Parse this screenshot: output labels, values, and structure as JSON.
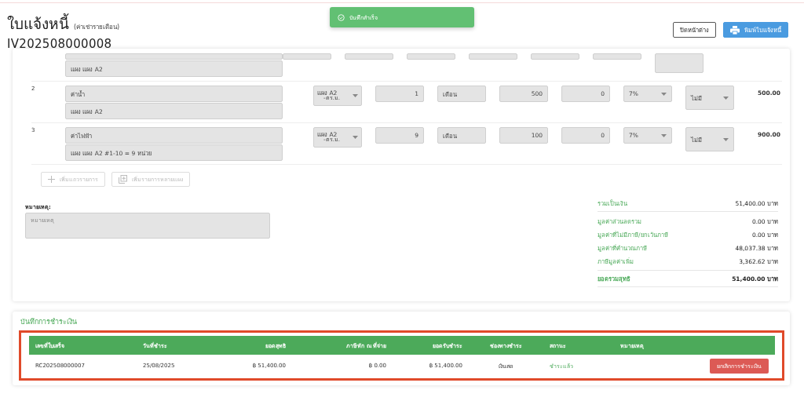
{
  "header": {
    "title": "ใบแจ้งหนี้",
    "subtitle": "(ค่าเช่ารายเดือน)",
    "number": "IV202508000008"
  },
  "toast": {
    "message": "บันทึกสำเร็จ"
  },
  "actions": [
    {
      "label": "ปิดหน้าต่าง",
      "kind": "outline"
    },
    {
      "label": "พิมพ์ใบแจ้งหนี้",
      "kind": "print"
    }
  ],
  "items": [
    {
      "kind": "partial",
      "detail": "แผง แผง A2"
    },
    {
      "kind": "full",
      "no": "2",
      "name": "ค่าน้ำ",
      "detail": "แผง แผง A2",
      "panel": "แผง A2",
      "panel_sub": "-ตร.ม.",
      "qty": "1",
      "unit": "เดือน",
      "price": "500",
      "discount": "0",
      "vat": "7%",
      "wht": "ไม่มี",
      "total": "500.00"
    },
    {
      "kind": "full",
      "no": "3",
      "name": "ค่าไฟฟ้า",
      "detail": "แผง แผง A2 #1-10 = 9 หน่วย",
      "panel": "แผง A2",
      "panel_sub": "-ตร.ม.",
      "qty": "9",
      "unit": "เดือน",
      "price": "100",
      "discount": "0",
      "vat": "7%",
      "wht": "ไม่มี",
      "total": "900.00"
    }
  ],
  "add_buttons": [
    {
      "label": "เพิ่มแถวรายการ",
      "kind": "plus",
      "disabled": true
    },
    {
      "label": "เพิ่มรายการหลายแผง",
      "kind": "multi",
      "disabled": true
    }
  ],
  "notes": {
    "label": "หมายเหตุ:",
    "placeholder": "หมายเหตุ"
  },
  "summary": [
    {
      "label": "รวมเป็นเงิน",
      "value": "51,400.00 บาท",
      "kind": "subtotal"
    },
    {
      "label": "มูลค่าส่วนลดรวม",
      "value": "0.00 บาท",
      "kind": "line"
    },
    {
      "label": "มูลค่าที่ไม่มีภาษี/ยกเว้นภาษี",
      "value": "0.00 บาท",
      "kind": "line"
    },
    {
      "label": "มูลค่าที่คำนวณภาษี",
      "value": "48,037.38 บาท",
      "kind": "line"
    },
    {
      "label": "ภาษีมูลค่าเพิ่ม",
      "value": "3,362.62 บาท",
      "kind": "line"
    },
    {
      "label": "ยอดรวมสุทธิ",
      "value": "51,400.00 บาท",
      "kind": "grand"
    }
  ],
  "payments": {
    "title": "บันทึกการชำระเงิน",
    "highlighted": true,
    "columns": [
      "เลขที่ใบเสร็จ",
      "วันที่ชำระ",
      "ยอดสุทธิ",
      "ภาษีหัก ณ ที่จ่าย",
      "ยอดรับชำระ",
      "ช่องทางชำระ",
      "สถานะ",
      "หมายเหตุ"
    ],
    "rows": [
      {
        "cells": [
          "RC202508000007",
          "25/08/2025",
          "฿ 51,400.00",
          "฿ 0.00",
          "฿ 51,400.00",
          "เงินสด"
        ],
        "status": "ชำระแล้ว",
        "action": "ยกเลิกการชำระเงิน"
      }
    ]
  }
}
